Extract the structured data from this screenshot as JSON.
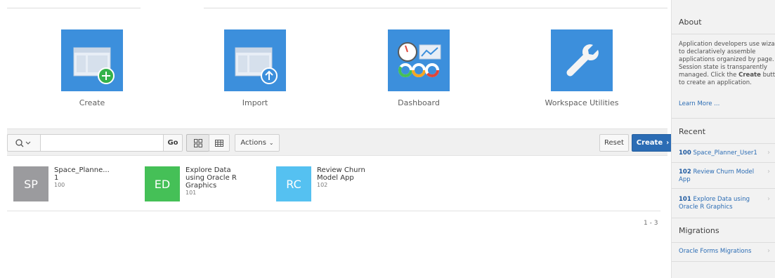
{
  "hero": {
    "tiles": [
      {
        "label": "Create",
        "icon": "create-app-icon"
      },
      {
        "label": "Import",
        "icon": "import-app-icon"
      },
      {
        "label": "Dashboard",
        "icon": "dashboard-icon"
      },
      {
        "label": "Workspace Utilities",
        "icon": "wrench-icon"
      }
    ]
  },
  "toolbar": {
    "search_icon": "search-icon",
    "search_value": "",
    "go_label": "Go",
    "actions_label": "Actions",
    "reset_label": "Reset",
    "create_label": "Create"
  },
  "apps": [
    {
      "initials": "SP",
      "name": "Space_Planne...\n1",
      "id": "100",
      "color": "#9b9b9e"
    },
    {
      "initials": "ED",
      "name": "Explore Data\nusing Oracle R\nGraphics",
      "id": "101",
      "color": "#45c057"
    },
    {
      "initials": "RC",
      "name": "Review Churn\nModel App",
      "id": "102",
      "color": "#55c1f1"
    }
  ],
  "pagination": {
    "range": "1 - 3"
  },
  "sidebar": {
    "about": {
      "title": "About",
      "text_before": "Application developers use wizards to declaratively assemble applications organized by page. Session state is transparently managed. Click the ",
      "text_bold": "Create",
      "text_after": " button to create an application.",
      "link": "Learn More ..."
    },
    "recent": {
      "title": "Recent",
      "items": [
        {
          "num": "100",
          "text": "Space_Planner_User1"
        },
        {
          "num": "102",
          "text": "Review Churn Model App"
        },
        {
          "num": "101",
          "text": "Explore Data using Oracle R Graphics"
        }
      ]
    },
    "migrations": {
      "title": "Migrations",
      "items": [
        {
          "text": "Oracle Forms Migrations"
        }
      ]
    }
  },
  "colors": {
    "tile_blue": "#3c8fdc",
    "primary_button": "#2b6cb4",
    "link": "#2b6cb4",
    "sidebar_bg": "#f2f2f2"
  }
}
